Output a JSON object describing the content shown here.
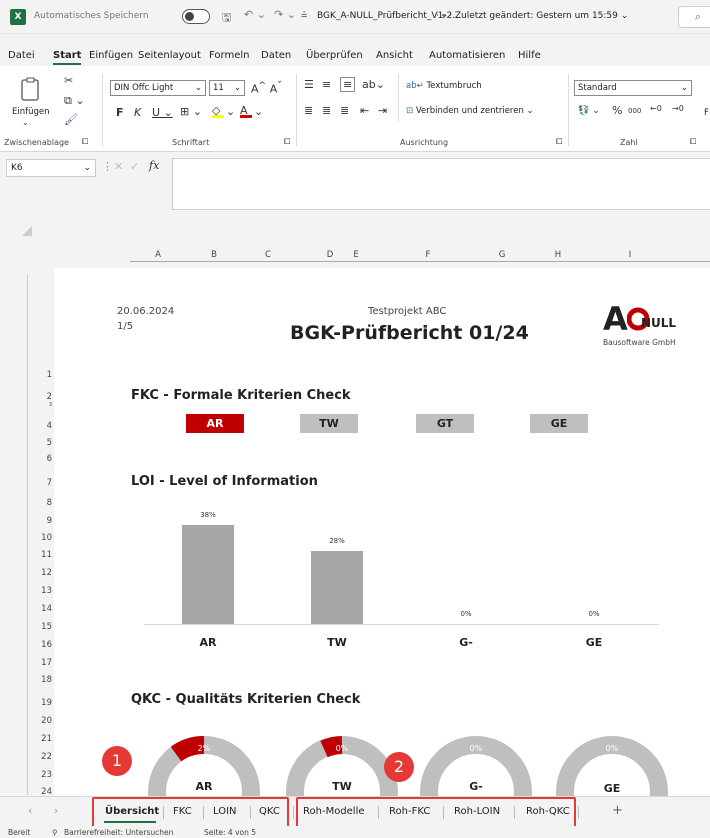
{
  "titlebar": {
    "autosave": "Automatisches Speichern",
    "filename": "BGK_A-NULL_Prüfbericht_V1-2...",
    "status": "Zuletzt geändert: Gestern um 15:59"
  },
  "menu": [
    "Datei",
    "Start",
    "Einfügen",
    "Seitenlayout",
    "Formeln",
    "Daten",
    "Überprüfen",
    "Ansicht",
    "Automatisieren",
    "Hilfe"
  ],
  "ribbon": {
    "paste": "Einfügen",
    "group_clipboard": "Zwischenablage",
    "font_name": "DIN Offc Light",
    "font_size": "11",
    "group_font": "Schriftart",
    "wrap": "Textumbruch",
    "merge": "Verbinden und zentrieren",
    "group_alignment": "Ausrichtung",
    "number_format": "Standard",
    "group_number": "Zahl"
  },
  "namebox": "K6",
  "fx": "fx",
  "columns": [
    "A",
    "B",
    "C",
    "D",
    "E",
    "F",
    "G",
    "H",
    "I"
  ],
  "rows": [
    "1",
    "2",
    "3",
    "4",
    "5",
    "6",
    "7",
    "8",
    "9",
    "10",
    "11",
    "12",
    "13",
    "14",
    "15",
    "16",
    "17",
    "18",
    "19",
    "20",
    "21",
    "22",
    "23",
    "24"
  ],
  "report": {
    "date": "20.06.2024",
    "page": "1/5",
    "project": "Testprojekt ABC",
    "title": "BGK-Prüfbericht 01/24",
    "logo_a": "A",
    "logo_null": "NULL",
    "logo_sub": "Bausoftware GmbH"
  },
  "fkc": {
    "title": "FKC - Formale Kriterien Check",
    "tags": [
      "AR",
      "TW",
      "GT",
      "GE"
    ],
    "colors": {
      "active": "#c00000",
      "inactive": "#bfbfbf"
    }
  },
  "chart_data": {
    "type": "bar",
    "title": "LOI - Level of Information",
    "categories": [
      "AR",
      "TW",
      "G-",
      "GE"
    ],
    "values": [
      38,
      28,
      0,
      0
    ],
    "labels": [
      "38%",
      "28%",
      "0%",
      "0%"
    ],
    "ylim": [
      0,
      40
    ]
  },
  "qkc": {
    "title": "QKC - Qualitäts Kriterien Check",
    "donuts": [
      {
        "label": "AR",
        "pct": "2%"
      },
      {
        "label": "TW",
        "pct": "0%"
      },
      {
        "label": "G-",
        "pct": "0%"
      },
      {
        "label": "GE",
        "pct": "0%"
      }
    ]
  },
  "sheets": [
    "Übersicht",
    "FKC",
    "LOIN",
    "QKC",
    "Roh-Modelle",
    "Roh-FKC",
    "Roh-LOIN",
    "Roh-QKC"
  ],
  "add_sheet": "+",
  "badges": [
    "1",
    "2"
  ],
  "status": {
    "ready": "Bereit",
    "accessibility": "Barrierefreiheit: Untersuchen",
    "page": "Seite: 4 von 5"
  }
}
